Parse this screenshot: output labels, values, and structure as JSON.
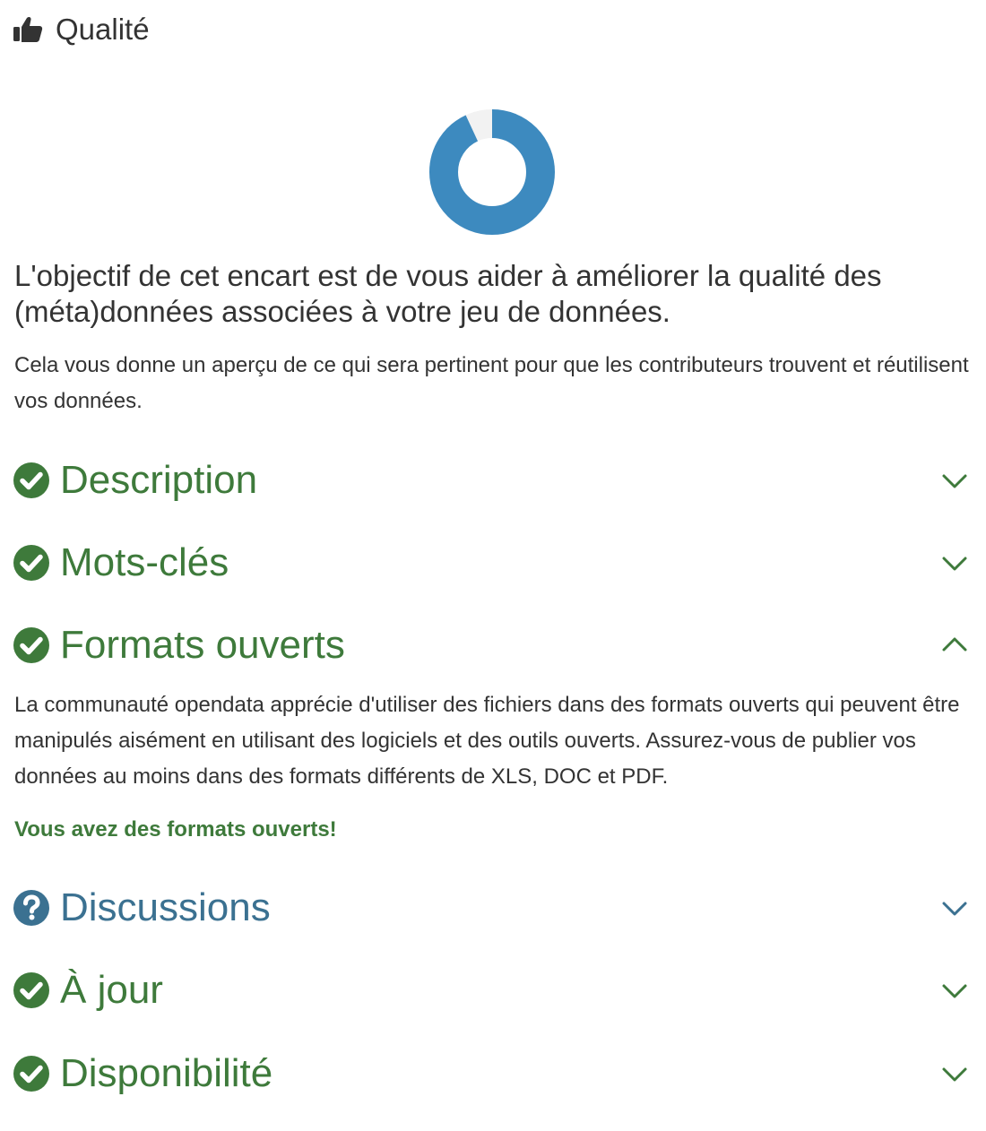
{
  "header": {
    "title": "Qualité",
    "icon": "thumbs-up-icon"
  },
  "score": {
    "value": 0.93,
    "fill_color": "#3d8abf",
    "track_color": "#f2f2f2"
  },
  "intro": {
    "lead": "L'objectif de cet encart est de vous aider à améliorer la qualité des (méta)données associées à votre jeu de données.",
    "sub": "Cela vous donne un aperçu de ce qui sera pertinent pour que les contributeurs trouvent et réutilisent vos données."
  },
  "colors": {
    "ok": "#3e7a3b",
    "warn": "#3b7191"
  },
  "criteria": [
    {
      "label": "Description",
      "status": "ok",
      "expanded": false
    },
    {
      "label": "Mots-clés",
      "status": "ok",
      "expanded": false
    },
    {
      "label": "Formats ouverts",
      "status": "ok",
      "expanded": true
    },
    {
      "label": "Discussions",
      "status": "question",
      "expanded": false
    },
    {
      "label": "À jour",
      "status": "ok",
      "expanded": false
    },
    {
      "label": "Disponibilité",
      "status": "ok",
      "expanded": false
    }
  ],
  "formats_detail": {
    "text": "La communauté opendata apprécie d'utiliser des fichiers dans des formats ouverts qui peuvent être manipulés aisément en utilisant des logiciels et des outils ouverts. Assurez-vous de publier vos données au moins dans des formats différents de XLS, DOC et PDF.",
    "success": "Vous avez des formats ouverts!"
  }
}
